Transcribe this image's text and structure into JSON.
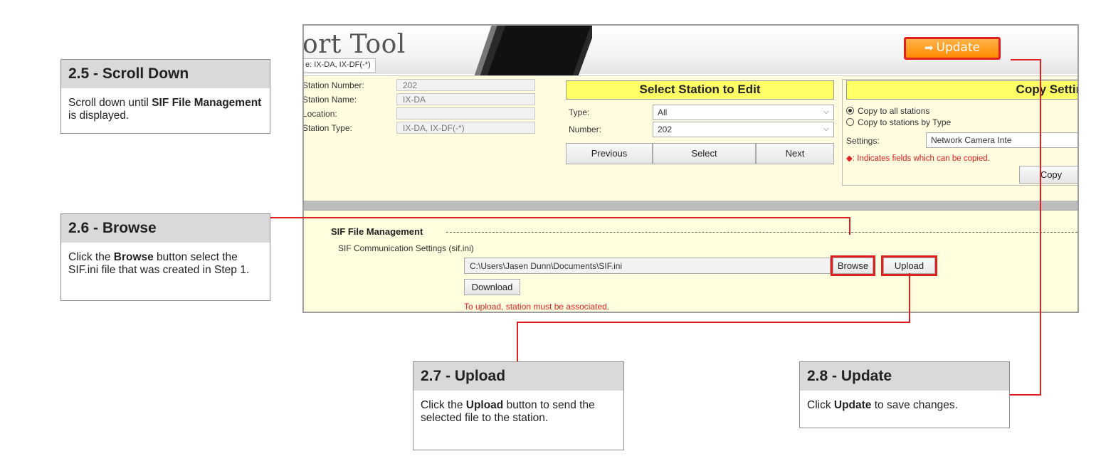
{
  "callouts": {
    "scroll": {
      "title": "2.5 - Scroll Down",
      "before": "Scroll down until ",
      "bold": "SIF File Management",
      "after": " is displayed."
    },
    "browse": {
      "title": "2.6 - Browse",
      "before": "Click the ",
      "bold": "Browse",
      "after": " button select the SIF.ini file that was created in Step 1."
    },
    "upload": {
      "title": "2.7 - Upload",
      "before": "Click the ",
      "bold": "Upload",
      "after": " button to send the selected file to the station."
    },
    "update": {
      "title": "2.8 - Update",
      "before": "Click ",
      "bold": "Update",
      "after": " to save changes."
    }
  },
  "app": {
    "title_partial": "ort Tool",
    "type_tab": "e: IX-DA, IX-DF(-*)",
    "update_label": "Update"
  },
  "station": {
    "number_label": "Station Number:",
    "number_value": "202",
    "name_label": "Station Name:",
    "name_value": "IX-DA",
    "location_label": "Location:",
    "location_value": "",
    "type_label": "Station Type:",
    "type_value": "IX-DA, IX-DF(-*)"
  },
  "select_panel": {
    "title": "Select Station to Edit",
    "type_label": "Type:",
    "type_value": "All",
    "number_label": "Number:",
    "number_value": "202",
    "previous": "Previous",
    "select": "Select",
    "next": "Next"
  },
  "copy_panel": {
    "title": "Copy Settin",
    "radio_all": "Copy to all stations",
    "radio_type": "Copy to stations by Type",
    "settings_label": "Settings:",
    "settings_value": "Network Camera Inte",
    "note": "◆: Indicates fields which can be copied.",
    "copy": "Copy"
  },
  "sif": {
    "title": "SIF File Management",
    "sub": "SIF Communication Settings (sif.ini)",
    "path": "C:\\Users\\Jasen Dunn\\Documents\\SIF.ini",
    "browse": "Browse",
    "upload": "Upload",
    "download": "Download",
    "note": "To upload, station must be associated."
  },
  "colors": {
    "highlight": "#e02020",
    "update_button": "#ff8a00",
    "panel_yellow": "#ffff66",
    "form_bg": "#fffce0"
  }
}
